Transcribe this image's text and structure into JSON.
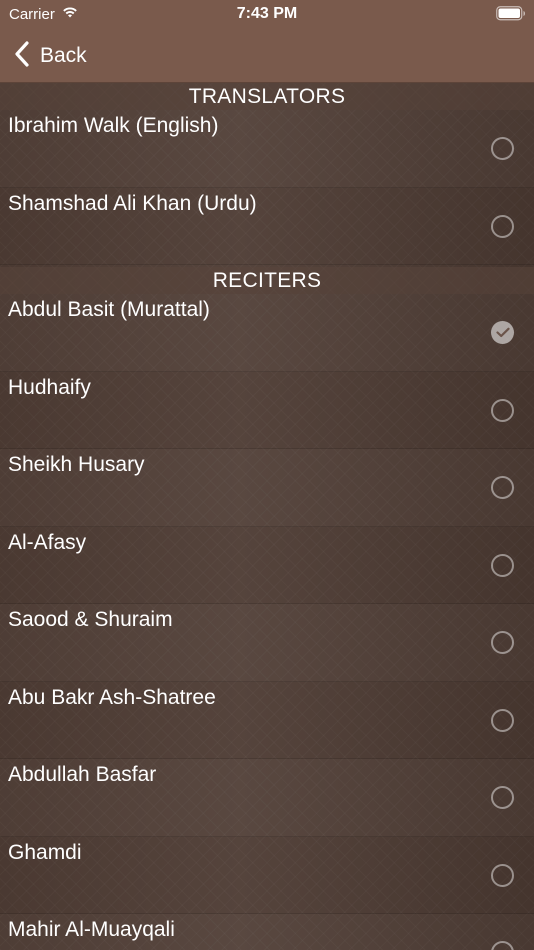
{
  "status": {
    "carrier": "Carrier",
    "time": "7:43 PM"
  },
  "nav": {
    "back_label": "Back"
  },
  "sections": [
    {
      "title": "TRANSLATORS",
      "items": [
        {
          "label": "Ibrahim Walk (English)",
          "selected": false
        },
        {
          "label": "Shamshad Ali Khan (Urdu)",
          "selected": false
        }
      ]
    },
    {
      "title": "RECITERS",
      "items": [
        {
          "label": "Abdul Basit (Murattal)",
          "selected": true
        },
        {
          "label": "Hudhaify",
          "selected": false
        },
        {
          "label": "Sheikh Husary",
          "selected": false
        },
        {
          "label": "Al-Afasy",
          "selected": false
        },
        {
          "label": "Saood & Shuraim",
          "selected": false
        },
        {
          "label": "Abu Bakr Ash-Shatree",
          "selected": false
        },
        {
          "label": "Abdullah Basfar",
          "selected": false
        },
        {
          "label": "Ghamdi",
          "selected": false
        },
        {
          "label": "Mahir Al-Muayqali",
          "selected": false
        }
      ]
    }
  ],
  "icons": {
    "wifi": "wifi-icon",
    "battery": "battery-icon",
    "back": "chevron-left-icon",
    "check": "checkmark-icon"
  }
}
